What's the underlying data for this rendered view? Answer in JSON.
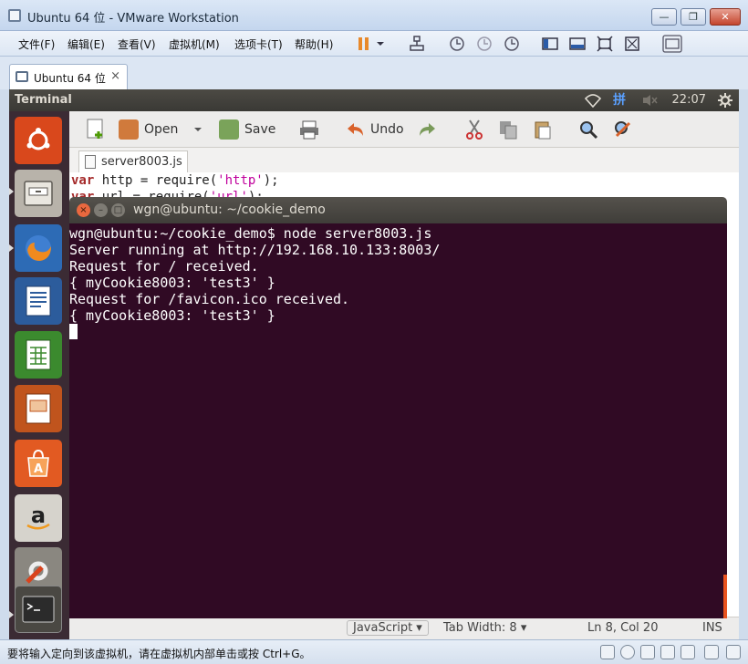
{
  "vmware": {
    "window_title": "Ubuntu 64 位 - VMware Workstation",
    "window_buttons": {
      "minimize": "—",
      "restore": "❐",
      "close": "✕"
    },
    "menu": [
      "文件(F)",
      "编辑(E)",
      "查看(V)",
      "虚拟机(M)",
      "选项卡(T)",
      "帮助(H)"
    ],
    "tab": {
      "label": "Ubuntu 64 位",
      "close": "×"
    },
    "status_hint": "要将输入定向到该虚拟机，请在虚拟机内部单击或按 Ctrl+G。"
  },
  "ubuntu_panel": {
    "app_title": "Terminal",
    "clock": "22:07",
    "input_method": "拼"
  },
  "gedit": {
    "toolbar": {
      "open": "Open",
      "save": "Save",
      "undo": "Undo"
    },
    "tab_name": "server8003.js",
    "code_line_1": {
      "kw": "var",
      "text": " http = require(",
      "str": "'http'",
      "end": ");"
    },
    "code_line_2": {
      "kw": "var",
      "text": " url = require(",
      "str": "'url'",
      "end": ");"
    },
    "status": {
      "language": "JavaScript ▾",
      "tab_width": "Tab Width: 8 ▾",
      "position": "Ln 8, Col 20",
      "mode": "INS"
    }
  },
  "terminal": {
    "title": "wgn@ubuntu: ~/cookie_demo",
    "lines": [
      "wgn@ubuntu:~/cookie_demo$ node server8003.js",
      "Server running at http://192.168.10.133:8003/",
      "Request for / received.",
      "{ myCookie8003: 'test3' }",
      "Request for /favicon.ico received.",
      "{ myCookie8003: 'test3' }"
    ]
  },
  "colors": {
    "terminal_bg": "#300a24",
    "ubuntu_orange": "#e95420",
    "launcher_bg": "#3b2b34"
  }
}
